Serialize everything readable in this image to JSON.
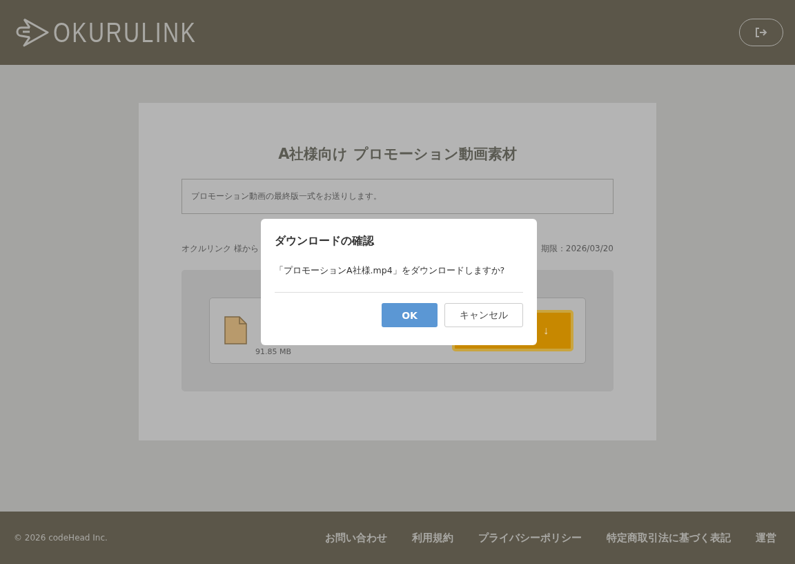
{
  "header": {
    "logo": "OKURULINK"
  },
  "card": {
    "title": "A社様向け プロモーション動画素材",
    "description": "プロモーション動画の最終版一式をお送りします。",
    "sender": "オクルリンク 様から",
    "deadline": "期限：2026/03/20",
    "files": [
      {
        "size": "91.85 MB",
        "download_glyph": "↓"
      }
    ]
  },
  "dialog": {
    "title": "ダウンロードの確認",
    "message": "「プロモーションA社様.mp4」をダウンロードしますか?",
    "buttons": [
      {
        "label": "OK",
        "kind": "primary"
      },
      {
        "label": "キャンセル",
        "kind": "secondary"
      }
    ]
  },
  "footer": {
    "copyright": "© 2026 codeHead Inc.",
    "links": [
      "お問い合わせ",
      "利用規約",
      "プライバシーポリシー",
      "特定商取引法に基づく表記",
      "運営"
    ]
  }
}
